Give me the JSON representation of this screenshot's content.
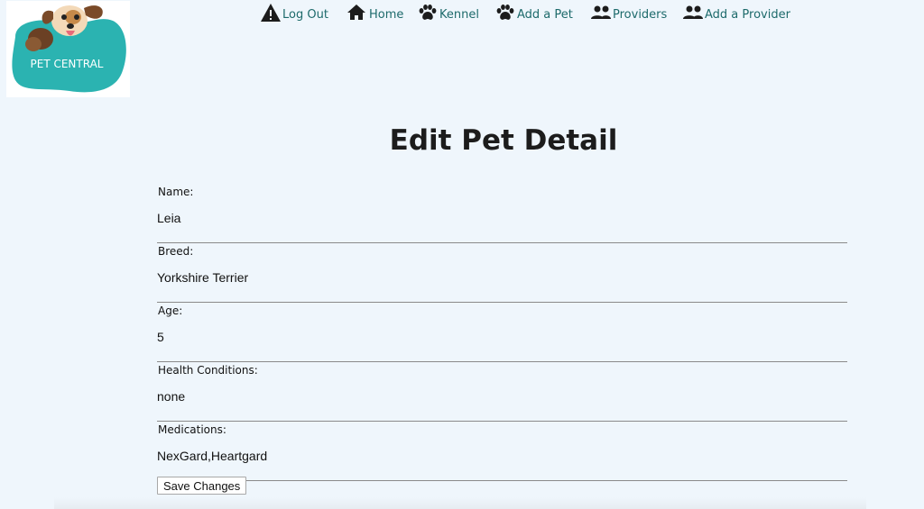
{
  "logo": {
    "text": "PET CENTRAL"
  },
  "nav": {
    "items": [
      {
        "label": "Log Out",
        "icon": "warning-icon"
      },
      {
        "label": "Home",
        "icon": "home-icon"
      },
      {
        "label": "Kennel",
        "icon": "paw-icon"
      },
      {
        "label": "Add a Pet",
        "icon": "paw-icon"
      },
      {
        "label": "Providers",
        "icon": "people-icon"
      },
      {
        "label": "Add a Provider",
        "icon": "people-icon"
      }
    ]
  },
  "page": {
    "title": "Edit Pet Detail"
  },
  "form": {
    "fields": [
      {
        "label": "Name:",
        "value": "Leia"
      },
      {
        "label": "Breed:",
        "value": "Yorkshire Terrier"
      },
      {
        "label": "Age:",
        "value": "5"
      },
      {
        "label": "Health Conditions:",
        "value": "none"
      },
      {
        "label": "Medications:",
        "value": "NexGard,Heartgard"
      }
    ],
    "submit_label": "Save Changes"
  },
  "colors": {
    "background": "#eff6fc",
    "nav_text": "#1d6a6b",
    "logo_teal": "#2bb3b1"
  }
}
